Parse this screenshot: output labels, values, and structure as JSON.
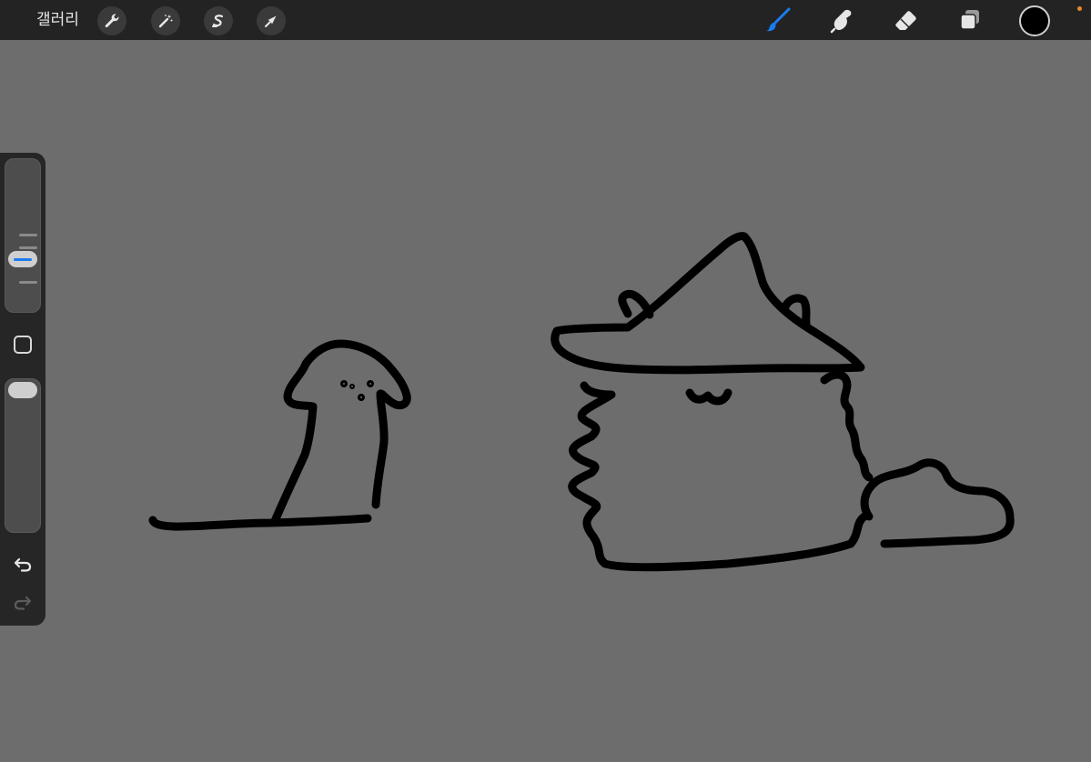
{
  "topbar": {
    "gallery_label": "갤러리",
    "left_tools": [
      {
        "name": "actions",
        "icon": "wrench-icon"
      },
      {
        "name": "adjustments",
        "icon": "magic-wand-icon"
      },
      {
        "name": "selection",
        "icon": "selection-s-icon"
      },
      {
        "name": "transform",
        "icon": "arrow-cursor-icon"
      }
    ],
    "right_tools": [
      {
        "name": "brush",
        "icon": "brush-icon",
        "active": true
      },
      {
        "name": "smudge",
        "icon": "smudge-finger-icon",
        "active": false
      },
      {
        "name": "eraser",
        "icon": "eraser-icon",
        "active": false
      },
      {
        "name": "layers",
        "icon": "layers-icon",
        "active": false
      }
    ],
    "current_color": "#000000"
  },
  "sidebar": {
    "brush_size_level": 0.65,
    "opacity_level": 0.95,
    "undo_icon": "undo-icon",
    "redo_icon": "redo-icon",
    "redo_enabled": false
  },
  "colors": {
    "canvas_bg": "#6d6d6d",
    "toolbar_bg": "#232323",
    "accent": "#1a7cf0",
    "stroke": "#000000"
  }
}
